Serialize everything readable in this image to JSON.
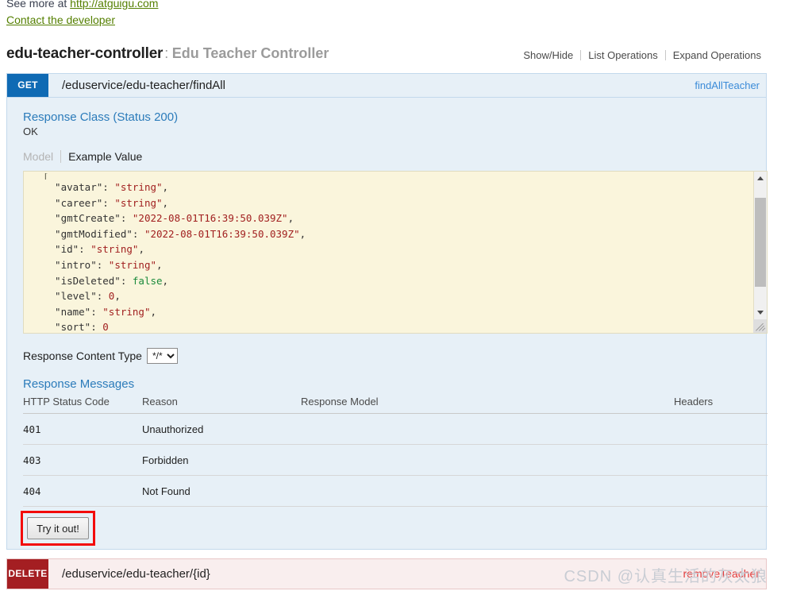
{
  "info": {
    "see_more_prefix": "See more at ",
    "see_more_link": "http://atguigu.com",
    "contact_link": "Contact the developer"
  },
  "resource": {
    "name": "edu-teacher-controller",
    "separator": ":",
    "description": "Edu Teacher Controller",
    "options": {
      "show_hide": "Show/Hide",
      "list_operations": "List Operations",
      "expand_operations": "Expand Operations"
    }
  },
  "operation_get": {
    "method": "GET",
    "method_color": "#0f6ab4",
    "path": "/eduservice/edu-teacher/findAll",
    "nickname": "findAllTeacher",
    "response_class_title": "Response Class (Status 200)",
    "response_class_status": "OK",
    "tabs": {
      "model": "Model",
      "example_value": "Example Value"
    },
    "example_value": {
      "first_line": "[",
      "entries": [
        {
          "key": "\"avatar\"",
          "value": "\"string\"",
          "type": "str",
          "comma": ","
        },
        {
          "key": "\"career\"",
          "value": "\"string\"",
          "type": "str",
          "comma": ","
        },
        {
          "key": "\"gmtCreate\"",
          "value": "\"2022-08-01T16:39:50.039Z\"",
          "type": "str",
          "comma": ","
        },
        {
          "key": "\"gmtModified\"",
          "value": "\"2022-08-01T16:39:50.039Z\"",
          "type": "str",
          "comma": ","
        },
        {
          "key": "\"id\"",
          "value": "\"string\"",
          "type": "str",
          "comma": ","
        },
        {
          "key": "\"intro\"",
          "value": "\"string\"",
          "type": "str",
          "comma": ","
        },
        {
          "key": "\"isDeleted\"",
          "value": "false",
          "type": "bool",
          "comma": ","
        },
        {
          "key": "\"level\"",
          "value": "0",
          "type": "num",
          "comma": ","
        },
        {
          "key": "\"name\"",
          "value": "\"string\"",
          "type": "str",
          "comma": ","
        },
        {
          "key": "\"sort\"",
          "value": "0",
          "type": "num",
          "comma": ""
        }
      ]
    },
    "content_type": {
      "label": "Response Content Type",
      "selected": "*/*",
      "options": [
        "*/*"
      ]
    },
    "response_messages": {
      "title": "Response Messages",
      "headers": [
        "HTTP Status Code",
        "Reason",
        "Response Model",
        "Headers"
      ],
      "rows": [
        {
          "code": "401",
          "reason": "Unauthorized",
          "model": "",
          "headers": ""
        },
        {
          "code": "403",
          "reason": "Forbidden",
          "model": "",
          "headers": ""
        },
        {
          "code": "404",
          "reason": "Not Found",
          "model": "",
          "headers": ""
        }
      ]
    },
    "try_it_out": "Try it out!",
    "highlight_color": "#f30b0b"
  },
  "operation_delete": {
    "method": "DELETE",
    "method_color": "#a41e22",
    "path": "/eduservice/edu-teacher/{id}",
    "nickname": "removeTeacher"
  },
  "watermark": "CSDN @认真生活的灰太狼"
}
